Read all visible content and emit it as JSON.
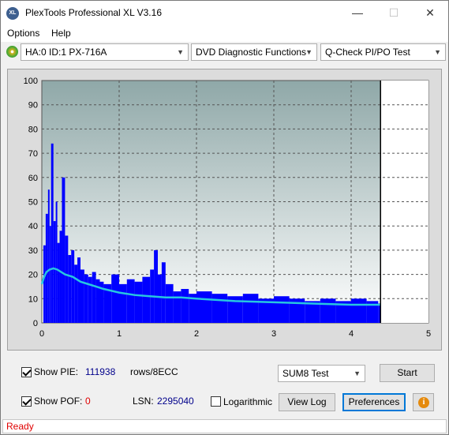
{
  "window": {
    "title": "PlexTools Professional XL V3.16",
    "app_icon_text": "XL",
    "minimize_glyph": "—",
    "maximize_glyph": "☐",
    "close_glyph": "✕"
  },
  "menu": {
    "items": [
      "Options",
      "Help"
    ]
  },
  "toolbar": {
    "drive": "HA:0 ID:1  PX-716A",
    "function": "DVD Diagnostic Functions",
    "test": "Q-Check PI/PO Test"
  },
  "chart_data": {
    "type": "bar",
    "xlabel": "",
    "ylabel": "",
    "x_ticks": [
      "0",
      "1",
      "2",
      "3",
      "4",
      "5"
    ],
    "y_ticks": [
      "0",
      "10",
      "20",
      "30",
      "40",
      "50",
      "60",
      "70",
      "80",
      "90",
      "100"
    ],
    "xlim": [
      0,
      5
    ],
    "ylim": [
      0,
      100
    ],
    "grid": true,
    "data_end_x": 4.38,
    "colors": {
      "bars": "#0000ff",
      "line": "#27c6e0",
      "plot_bg_top": "#8fa8a8",
      "plot_bg_bottom": "#ffffff",
      "marker": "#000000"
    },
    "series": [
      {
        "type": "bar",
        "x": [
          0.02,
          0.05,
          0.08,
          0.1,
          0.12,
          0.15,
          0.18,
          0.2,
          0.23,
          0.26,
          0.3,
          0.34,
          0.38,
          0.42,
          0.46,
          0.5,
          0.55,
          0.6,
          0.65,
          0.7,
          0.75,
          0.8,
          0.9,
          1.0,
          1.1,
          1.2,
          1.3,
          1.4,
          1.45,
          1.5,
          1.55,
          1.6,
          1.7,
          1.8,
          1.9,
          2.0,
          2.2,
          2.4,
          2.6,
          2.8,
          3.0,
          3.2,
          3.4,
          3.6,
          3.8,
          4.0,
          4.2,
          4.35
        ],
        "values": [
          32,
          45,
          55,
          40,
          74,
          42,
          50,
          33,
          38,
          60,
          36,
          28,
          30,
          24,
          27,
          22,
          20,
          19,
          21,
          18,
          17,
          16,
          20,
          16,
          18,
          17,
          19,
          22,
          30,
          20,
          25,
          16,
          13,
          14,
          12,
          13,
          12,
          11,
          12,
          10,
          11,
          10,
          9,
          10,
          9,
          10,
          9,
          8
        ]
      },
      {
        "type": "line",
        "x": [
          0,
          0.03,
          0.06,
          0.1,
          0.15,
          0.2,
          0.3,
          0.4,
          0.5,
          0.6,
          0.7,
          0.8,
          1.0,
          1.2,
          1.4,
          1.6,
          1.8,
          2.0,
          2.5,
          3.0,
          3.5,
          4.0,
          4.38
        ],
        "values": [
          16,
          19,
          21,
          22,
          22.5,
          22,
          20,
          19,
          17,
          16,
          15,
          14,
          12.5,
          11.5,
          11,
          10.5,
          10.5,
          10,
          9,
          8.5,
          8,
          7.5,
          7.5
        ]
      }
    ]
  },
  "controls": {
    "show_pie_label": "Show PIE:",
    "pie_value": "111938",
    "rows_label": "rows/8ECC",
    "show_pof_label": "Show POF:",
    "pof_value": "0",
    "lsn_label": "LSN:",
    "lsn_value": "2295040",
    "logarithmic_label": "Logarithmic",
    "test_select": "SUM8 Test",
    "start_label": "Start",
    "view_log_label": "View Log",
    "preferences_label": "Preferences",
    "info_glyph": "i",
    "show_pie_checked": true,
    "show_pof_checked": true,
    "logarithmic_checked": false,
    "value_color": "#00008b",
    "pof_color": "#e00000"
  },
  "status": {
    "text": "Ready"
  }
}
